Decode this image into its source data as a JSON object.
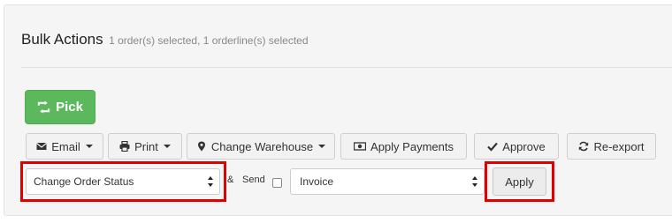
{
  "header": {
    "title": "Bulk Actions",
    "subtitle": "1 order(s) selected, 1 orderline(s) selected"
  },
  "pick_button": {
    "label": "Pick",
    "icon": "retweet-icon"
  },
  "toolbar": {
    "email": {
      "label": "Email",
      "icon": "envelope-icon"
    },
    "print": {
      "label": "Print",
      "icon": "printer-icon"
    },
    "change_warehouse": {
      "label": "Change Warehouse",
      "icon": "map-marker-icon"
    },
    "apply_payments": {
      "label": "Apply Payments",
      "icon": "money-icon"
    },
    "approve": {
      "label": "Approve",
      "icon": "check-icon"
    },
    "re_export": {
      "label": "Re-export",
      "icon": "refresh-icon"
    }
  },
  "action_row": {
    "status_select": {
      "value": "Change Order Status"
    },
    "ampersand": "&",
    "send_label": "Send",
    "send_checked": false,
    "document_select": {
      "value": "Invoice"
    },
    "apply_label": "Apply"
  },
  "colors": {
    "primary_green": "#5cb85c",
    "highlight_red": "#e00000",
    "panel_bg": "#f5f5f5"
  }
}
